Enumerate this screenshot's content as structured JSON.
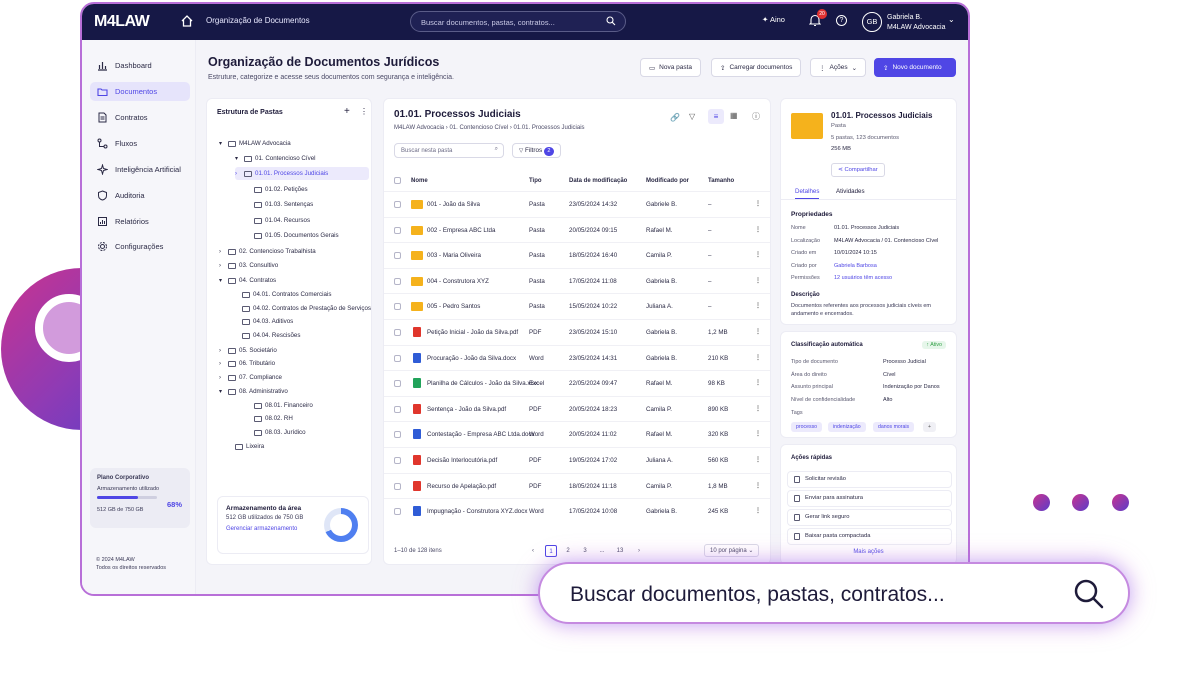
{
  "app": {
    "logo": "M4LAW",
    "breadcrumb": "Organização de Documentos"
  },
  "topbar": {
    "search_placeholder": "Buscar documentos, pastas, contratos...",
    "aino": "Aino",
    "notif_count": "20",
    "help": "?",
    "avatar": "GB",
    "user_name": "Gabriela B.",
    "user_org": "M4LAW Advocacia"
  },
  "sidebar": {
    "items": [
      {
        "label": "Dashboard",
        "icon": "chart-icon"
      },
      {
        "label": "Documentos",
        "icon": "folder-icon",
        "active": true
      },
      {
        "label": "Contratos",
        "icon": "document-icon"
      },
      {
        "label": "Fluxos",
        "icon": "flow-icon"
      },
      {
        "label": "Inteligência Artificial",
        "icon": "sparkle-icon"
      },
      {
        "label": "Auditoria",
        "icon": "shield-icon"
      },
      {
        "label": "Relatórios",
        "icon": "report-icon"
      },
      {
        "label": "Configurações",
        "icon": "gear-icon"
      }
    ],
    "plan": {
      "title": "Plano Corporativo",
      "label": "Armazenamento utilizado",
      "pct": "68%",
      "pct_value": 0.68,
      "used": "512 GB de 750 GB"
    },
    "copyright": "© 2024 M4LAW",
    "rights": "Todos os direitos reservados"
  },
  "page": {
    "title": "Organização de Documentos Jurídicos",
    "subtitle": "Estruture, categorize e acesse seus documentos com segurança e inteligência.",
    "buttons": {
      "new_folder": "Nova pasta",
      "upload": "Carregar documentos",
      "actions": "Ações",
      "new_doc": "Novo documento"
    }
  },
  "tree": {
    "title": "Estrutura de Pastas",
    "nodes": [
      "M4LAW Advocacia",
      "01. Contencioso Cível",
      "01.01. Processos Judiciais",
      "01.02. Petições",
      "01.03. Sentenças",
      "01.04. Recursos",
      "01.05. Documentos Gerais",
      "02. Contencioso Trabalhista",
      "03. Consultivo",
      "04. Contratos",
      "04.01. Contratos Comerciais",
      "04.02. Contratos de Prestação de Serviços",
      "04.03. Aditivos",
      "04.04. Rescisões",
      "05. Societário",
      "06. Tributário",
      "07. Compliance",
      "08. Administrativo",
      "08.01. Financeiro",
      "08.02. RH",
      "08.03. Jurídico",
      "Lixeira"
    ],
    "storage": {
      "title": "Armazenamento da área",
      "used": "512 GB utilizados de 750 GB",
      "link": "Gerenciar armazenamento",
      "pct_value": 0.68
    }
  },
  "list": {
    "title": "01.01. Processos Judiciais",
    "breadcrumb": "M4LAW Advocacia  ›  01. Contencioso Cível  ›  01.01. Processos Judiciais",
    "search_placeholder": "Buscar nesta pasta",
    "filters": "Filtros",
    "filters_count": "2",
    "columns": [
      "Nome",
      "Tipo",
      "Data de modificação",
      "Modificado por",
      "Tamanho"
    ],
    "rows": [
      {
        "name": "001 - João da Silva",
        "type": "Pasta",
        "date": "23/05/2024 14:32",
        "by": "Gabriele B.",
        "size": "–",
        "kind": "folder"
      },
      {
        "name": "002 - Empresa ABC Ltda",
        "type": "Pasta",
        "date": "20/05/2024 09:15",
        "by": "Rafael M.",
        "size": "–",
        "kind": "folder"
      },
      {
        "name": "003 - Maria Oliveira",
        "type": "Pasta",
        "date": "18/05/2024 16:40",
        "by": "Camila P.",
        "size": "–",
        "kind": "folder"
      },
      {
        "name": "004 - Construtora XYZ",
        "type": "Pasta",
        "date": "17/05/2024 11:08",
        "by": "Gabriela B.",
        "size": "–",
        "kind": "folder"
      },
      {
        "name": "005 - Pedro Santos",
        "type": "Pasta",
        "date": "15/05/2024 10:22",
        "by": "Juliana A.",
        "size": "–",
        "kind": "folder"
      },
      {
        "name": "Petição Inicial - João da Silva.pdf",
        "type": "PDF",
        "date": "23/05/2024 15:10",
        "by": "Gabriela B.",
        "size": "1,2 MB",
        "kind": "pdf"
      },
      {
        "name": "Procuração - João da Silva.docx",
        "type": "Word",
        "date": "23/05/2024 14:31",
        "by": "Gabriela B.",
        "size": "210 KB",
        "kind": "word"
      },
      {
        "name": "Planilha de Cálculos - João da Silva.xlsx",
        "type": "Excel",
        "date": "22/05/2024 09:47",
        "by": "Rafael M.",
        "size": "98 KB",
        "kind": "excel"
      },
      {
        "name": "Sentença - João da Silva.pdf",
        "type": "PDF",
        "date": "20/05/2024 18:23",
        "by": "Camila P.",
        "size": "890 KB",
        "kind": "pdf"
      },
      {
        "name": "Contestação - Empresa ABC Ltda.docx",
        "type": "Word",
        "date": "20/05/2024 11:02",
        "by": "Rafael M.",
        "size": "320 KB",
        "kind": "word"
      },
      {
        "name": "Decisão Interlocutória.pdf",
        "type": "PDF",
        "date": "19/05/2024 17:02",
        "by": "Juliana A.",
        "size": "560 KB",
        "kind": "pdf"
      },
      {
        "name": "Recurso de Apelação.pdf",
        "type": "PDF",
        "date": "18/05/2024 11:18",
        "by": "Camila P.",
        "size": "1,8 MB",
        "kind": "pdf"
      },
      {
        "name": "Impugnação - Construtora XYZ.docx",
        "type": "Word",
        "date": "17/05/2024 10:08",
        "by": "Gabriela B.",
        "size": "245 KB",
        "kind": "word"
      }
    ],
    "pager": {
      "summary": "1–10 de 128 itens",
      "pages": [
        "1",
        "2",
        "3",
        "...",
        "13"
      ],
      "per_page": "10 por página"
    }
  },
  "details": {
    "title": "01.01. Processos Judiciais",
    "type": "Pasta",
    "counts": "5 pastas, 123 documentos",
    "size": "256 MB",
    "share": "Compartilhar",
    "tabs": [
      "Detalhes",
      "Atividades"
    ],
    "props_title": "Propriedades",
    "props": [
      {
        "k": "Nome",
        "v": "01.01. Processos Judiciais"
      },
      {
        "k": "Localização",
        "v": "M4LAW Advocacia / 01. Contencioso Cível"
      },
      {
        "k": "Criado em",
        "v": "10/01/2024 10:15"
      },
      {
        "k": "Criado por",
        "v": "Gabriela Barbosa"
      },
      {
        "k": "Permissões",
        "v": "12 usuários têm acesso"
      }
    ],
    "desc_title": "Descrição",
    "desc": "Documentos referentes aos processos judiciais cíveis em andamento e encerrados."
  },
  "classification": {
    "title": "Classificação automática",
    "status": "Ativo",
    "rows": [
      {
        "k": "Tipo de documento",
        "v": "Processo Judicial"
      },
      {
        "k": "Área do direito",
        "v": "Cível"
      },
      {
        "k": "Assunto principal",
        "v": "Indenização por Danos"
      },
      {
        "k": "Nível de confidencialidade",
        "v": "Alto"
      }
    ],
    "tags_label": "Tags",
    "tags": [
      "processo",
      "indenização",
      "danos morais"
    ]
  },
  "quick": {
    "title": "Ações rápidas",
    "actions": [
      "Solicitar revisão",
      "Enviar para assinatura",
      "Gerar link seguro",
      "Baixar pasta compactada"
    ],
    "more": "Mais ações"
  },
  "hero_search": {
    "text": "Buscar documentos, pastas, contratos..."
  }
}
